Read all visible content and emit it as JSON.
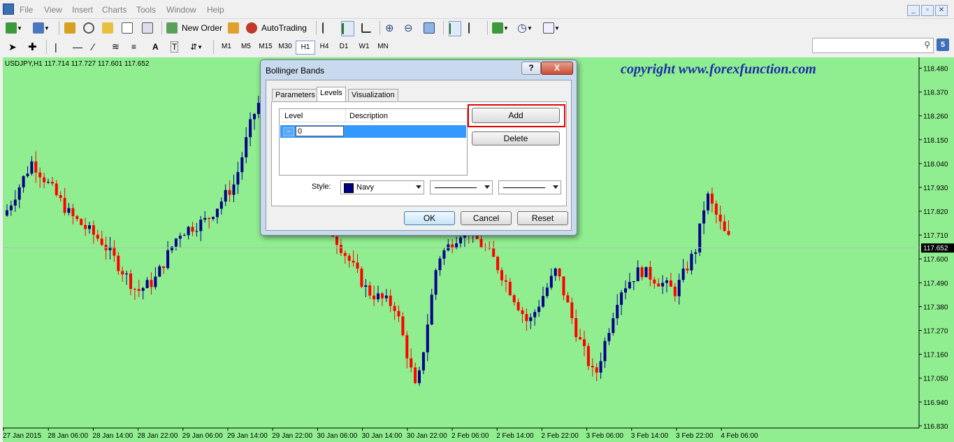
{
  "menu": {
    "items": [
      "File",
      "View",
      "Insert",
      "Charts",
      "Tools",
      "Window",
      "Help"
    ]
  },
  "toolbar": {
    "new_order_label": "New Order",
    "autotrading_label": "AutoTrading"
  },
  "timeframes": [
    "M1",
    "M5",
    "M15",
    "M30",
    "H1",
    "H4",
    "D1",
    "W1",
    "MN"
  ],
  "active_timeframe": "H1",
  "search": {
    "placeholder": ""
  },
  "badge": "5",
  "chart": {
    "symbol_info": "USDJPY,H1  117.714 117.727 117.601 117.652",
    "watermark": "copyright  www.forexfunction.com",
    "current_price": "117.652",
    "background": "#90ee90",
    "bull_color": "#00008b",
    "bear_color": "#ff0000"
  },
  "chart_data": {
    "type": "candlestick",
    "y_ticks": [
      "118.480",
      "118.370",
      "118.260",
      "118.150",
      "118.040",
      "117.930",
      "117.820",
      "117.710",
      "117.600",
      "117.490",
      "117.380",
      "117.270",
      "117.160",
      "117.050",
      "116.940",
      "116.830"
    ],
    "x_ticks": [
      "27 Jan 2015",
      "28 Jan 06:00",
      "28 Jan 14:00",
      "28 Jan 22:00",
      "29 Jan 06:00",
      "29 Jan 14:00",
      "29 Jan 22:00",
      "30 Jan 06:00",
      "30 Jan 14:00",
      "30 Jan 22:00",
      "2 Feb 06:00",
      "2 Feb 14:00",
      "2 Feb 22:00",
      "3 Feb 06:00",
      "3 Feb 14:00",
      "3 Feb 22:00",
      "4 Feb 06:00"
    ],
    "ylim": [
      116.82,
      118.53
    ],
    "current_price": 117.652
  },
  "dialog": {
    "title": "Bollinger Bands",
    "help_label": "?",
    "close_label": "X",
    "tabs": [
      "Parameters",
      "Levels",
      "Visualization"
    ],
    "active_tab": "Levels",
    "list": {
      "headers": [
        "Level",
        "Description"
      ],
      "rows": [
        {
          "level": "0",
          "description": ""
        }
      ]
    },
    "add_label": "Add",
    "delete_label": "Delete",
    "style_label": "Style:",
    "color_name": "Navy",
    "color_value": "#000080",
    "ok_label": "OK",
    "cancel_label": "Cancel",
    "reset_label": "Reset"
  }
}
